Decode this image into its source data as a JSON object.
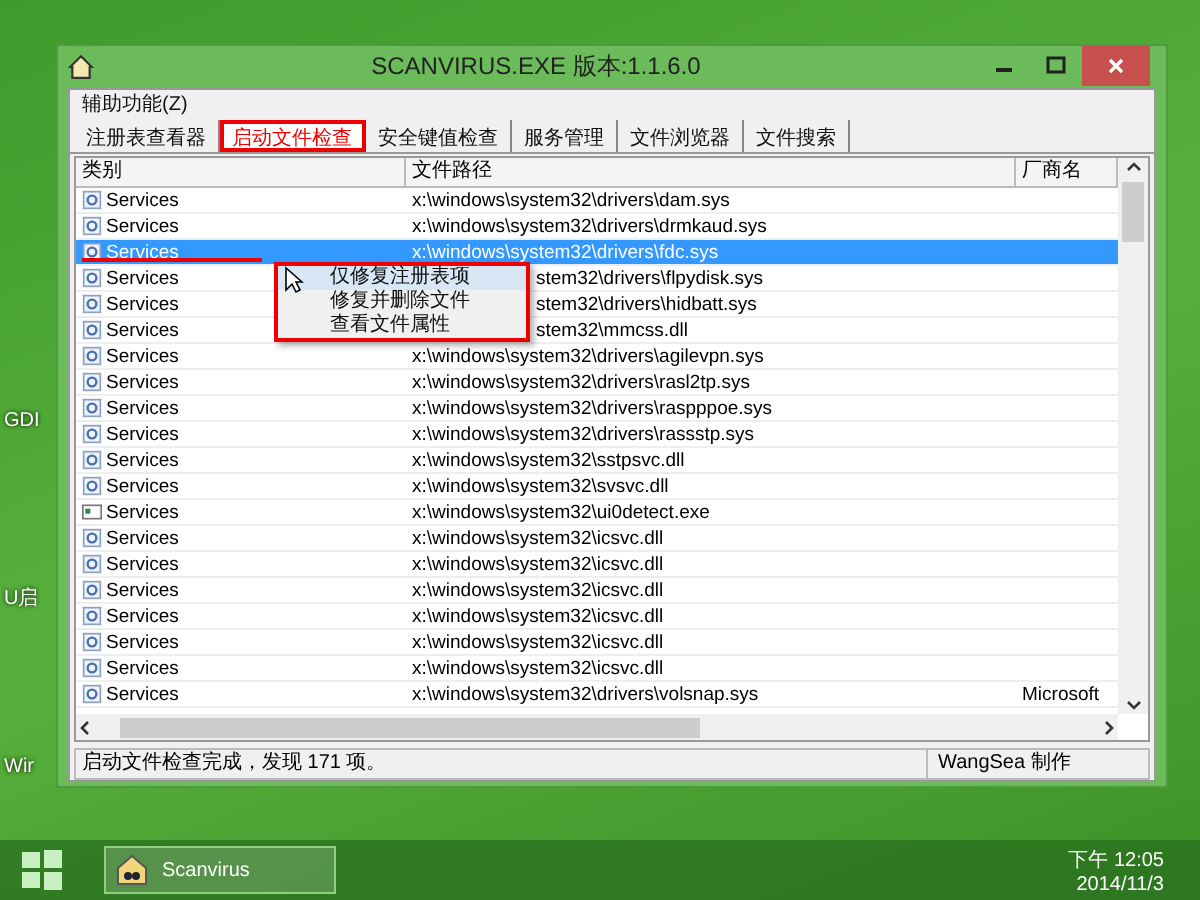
{
  "desktop": {
    "icons": [
      {
        "label": "GDI"
      },
      {
        "label": "U启"
      },
      {
        "label": "Wir"
      }
    ]
  },
  "window": {
    "title": "SCANVIRUS.EXE  版本:1.1.6.0",
    "menu": [
      "辅助功能(Z)"
    ],
    "tabs": [
      {
        "label": "注册表查看器",
        "selected": false
      },
      {
        "label": "启动文件检查",
        "selected": true
      },
      {
        "label": "安全键值检查",
        "selected": false
      },
      {
        "label": "服务管理",
        "selected": false
      },
      {
        "label": "文件浏览器",
        "selected": false
      },
      {
        "label": "文件搜索",
        "selected": false
      }
    ],
    "table": {
      "columns": [
        "类别",
        "文件路径",
        "厂商名"
      ],
      "rows": [
        {
          "kind": "service",
          "category": "Services",
          "path": "x:\\windows\\system32\\drivers\\dam.sys",
          "selected": false
        },
        {
          "kind": "service",
          "category": "Services",
          "path": "x:\\windows\\system32\\drivers\\drmkaud.sys",
          "selected": false
        },
        {
          "kind": "service",
          "category": "Services",
          "path": "x:\\windows\\system32\\drivers\\fdc.sys",
          "selected": true
        },
        {
          "kind": "service",
          "category": "Services",
          "path": "stem32\\drivers\\flpydisk.sys",
          "covered": true,
          "selected": false
        },
        {
          "kind": "service",
          "category": "Services",
          "path": "stem32\\drivers\\hidbatt.sys",
          "covered": true,
          "selected": false
        },
        {
          "kind": "service",
          "category": "Services",
          "path": "stem32\\mmcss.dll",
          "covered": true,
          "selected": false
        },
        {
          "kind": "service",
          "category": "Services",
          "path": "x:\\windows\\system32\\drivers\\agilevpn.sys",
          "selected": false
        },
        {
          "kind": "service",
          "category": "Services",
          "path": "x:\\windows\\system32\\drivers\\rasl2tp.sys",
          "selected": false
        },
        {
          "kind": "service",
          "category": "Services",
          "path": "x:\\windows\\system32\\drivers\\raspppoe.sys",
          "selected": false
        },
        {
          "kind": "service",
          "category": "Services",
          "path": "x:\\windows\\system32\\drivers\\rassstp.sys",
          "selected": false
        },
        {
          "kind": "service",
          "category": "Services",
          "path": "x:\\windows\\system32\\sstpsvc.dll",
          "selected": false
        },
        {
          "kind": "service",
          "category": "Services",
          "path": "x:\\windows\\system32\\svsvc.dll",
          "selected": false
        },
        {
          "kind": "program",
          "category": "Services",
          "path": "x:\\windows\\system32\\ui0detect.exe",
          "selected": false
        },
        {
          "kind": "service",
          "category": "Services",
          "path": "x:\\windows\\system32\\icsvc.dll",
          "selected": false
        },
        {
          "kind": "service",
          "category": "Services",
          "path": "x:\\windows\\system32\\icsvc.dll",
          "selected": false
        },
        {
          "kind": "service",
          "category": "Services",
          "path": "x:\\windows\\system32\\icsvc.dll",
          "selected": false
        },
        {
          "kind": "service",
          "category": "Services",
          "path": "x:\\windows\\system32\\icsvc.dll",
          "selected": false
        },
        {
          "kind": "service",
          "category": "Services",
          "path": "x:\\windows\\system32\\icsvc.dll",
          "selected": false
        },
        {
          "kind": "service",
          "category": "Services",
          "path": "x:\\windows\\system32\\icsvc.dll",
          "selected": false
        },
        {
          "kind": "service",
          "category": "Services",
          "path": "x:\\windows\\system32\\drivers\\volsnap.sys",
          "vendor": "Microsoft",
          "selected": false
        }
      ]
    },
    "context_menu": [
      {
        "label": "仅修复注册表项",
        "selected": true
      },
      {
        "label": "修复并删除文件",
        "selected": false
      },
      {
        "label": "查看文件属性",
        "selected": false
      }
    ],
    "status_bar": {
      "message": "启动文件检查完成，发现 171 项。",
      "author": "WangSea 制作"
    }
  },
  "taskbar": {
    "app": "Scanvirus",
    "time": "下午 12:05",
    "date": "2014/11/3"
  }
}
